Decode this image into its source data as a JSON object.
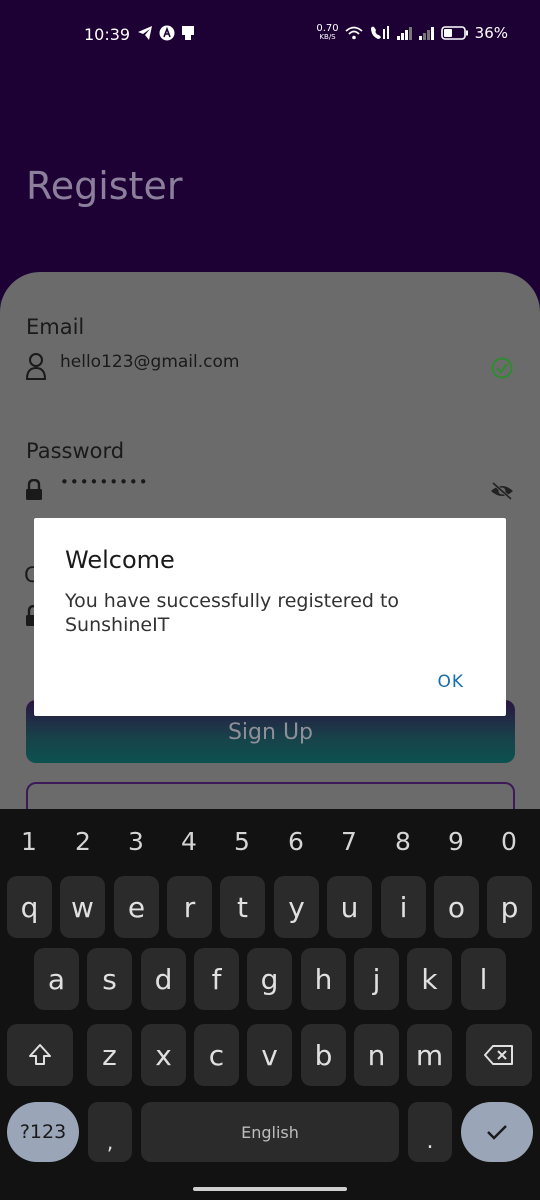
{
  "status_bar": {
    "time": "10:39",
    "net_speed_value": "0.70",
    "net_speed_unit": "KB/S",
    "battery": "36%"
  },
  "header": {
    "title": "Register"
  },
  "form": {
    "email_label": "Email",
    "email_value": "hello123@gmail.com",
    "password_label": "Password",
    "password_value": "•••••••••",
    "signup_label": "Sign Up"
  },
  "dialog": {
    "title": "Welcome",
    "message": "You have successfully registered to SunshineIT",
    "ok_label": "OK"
  },
  "keyboard": {
    "numbers": [
      "1",
      "2",
      "3",
      "4",
      "5",
      "6",
      "7",
      "8",
      "9",
      "0"
    ],
    "row1": [
      "q",
      "w",
      "e",
      "r",
      "t",
      "y",
      "u",
      "i",
      "o",
      "p"
    ],
    "row2": [
      "a",
      "s",
      "d",
      "f",
      "g",
      "h",
      "j",
      "k",
      "l"
    ],
    "row3": [
      "z",
      "x",
      "c",
      "v",
      "b",
      "n",
      "m"
    ],
    "sym_label": "?123",
    "comma": ",",
    "space_label": "English",
    "period": "."
  },
  "colors": {
    "header_bg": "#1d0134",
    "dialog_ok": "#1a6ea8",
    "success_check": "#2e8b2e"
  }
}
